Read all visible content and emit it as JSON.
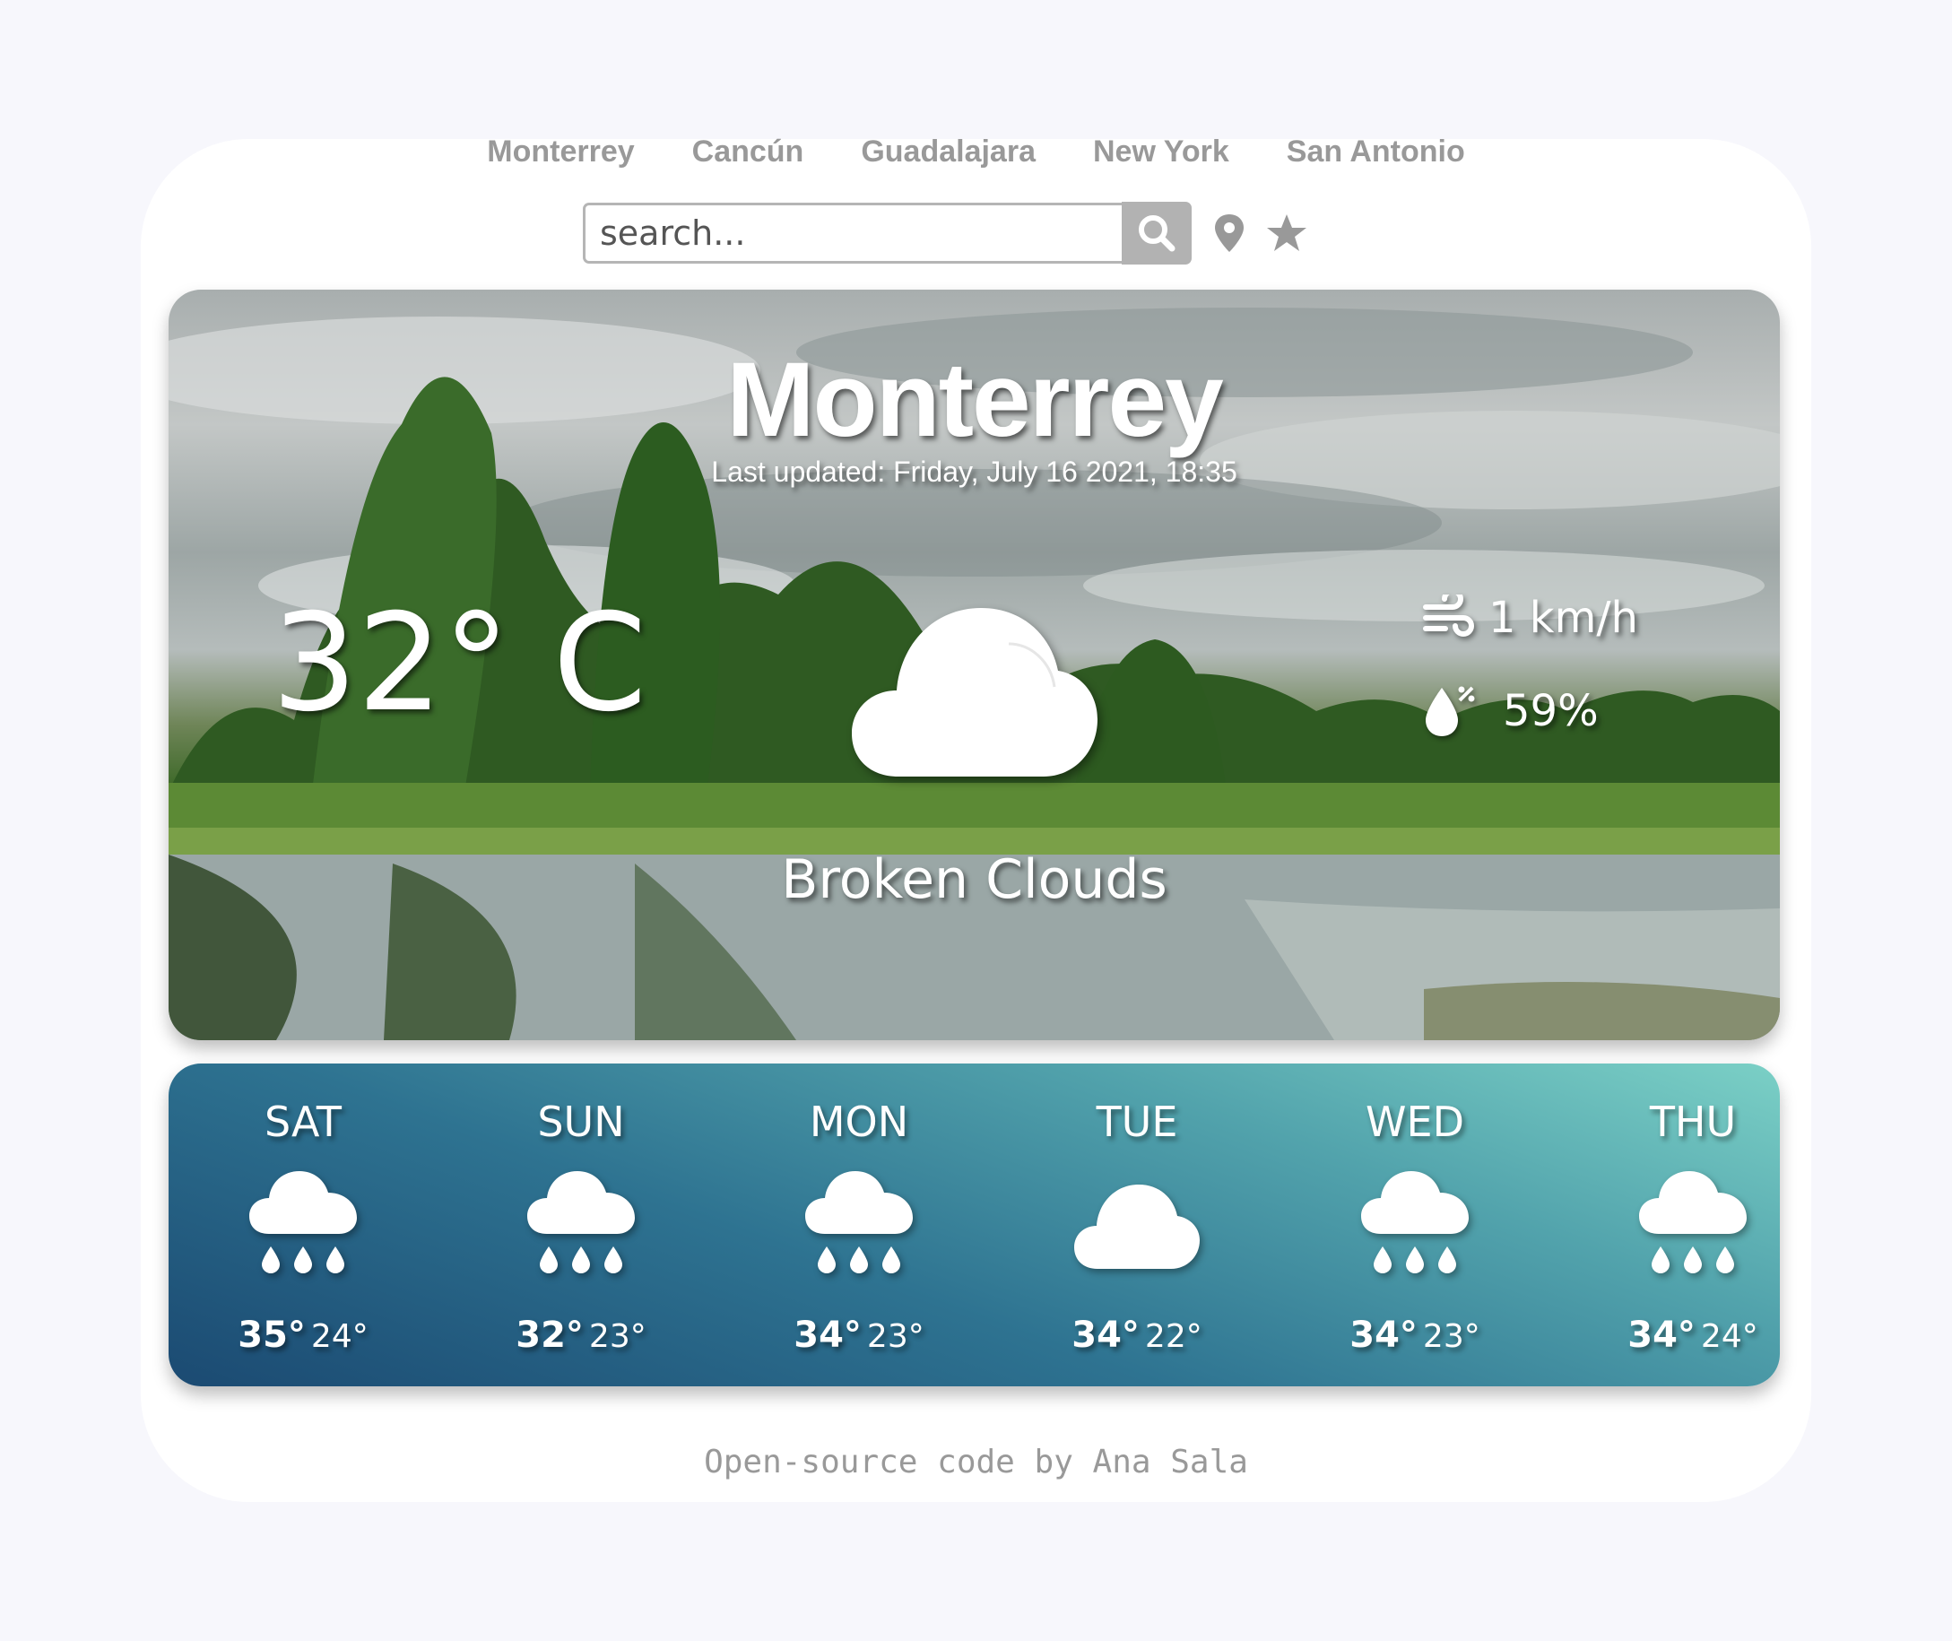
{
  "nav": {
    "cities": [
      "Monterrey",
      "Cancún",
      "Guadalajara",
      "New York",
      "San Antonio"
    ]
  },
  "search": {
    "placeholder": "search...",
    "value": "",
    "button_icon": "search-icon",
    "location_icon": "map-pin-icon",
    "favorite_icon": "star-icon"
  },
  "current": {
    "city": "Monterrey",
    "last_updated": "Last updated: Friday, July 16 2021, 18:35",
    "temperature": "32° C",
    "description": "Broken Clouds",
    "icon": "cloud-icon",
    "wind": "1 km/h",
    "wind_icon": "wind-icon",
    "humidity": "59%",
    "humidity_icon": "humidity-icon"
  },
  "forecast": [
    {
      "day": "SAT",
      "max": "35°",
      "min": "24°",
      "icon": "rain-icon"
    },
    {
      "day": "SUN",
      "max": "32°",
      "min": "23°",
      "icon": "rain-icon"
    },
    {
      "day": "MON",
      "max": "34°",
      "min": "23°",
      "icon": "rain-icon"
    },
    {
      "day": "TUE",
      "max": "34°",
      "min": "22°",
      "icon": "cloud-icon"
    },
    {
      "day": "WED",
      "max": "34°",
      "min": "23°",
      "icon": "rain-icon"
    },
    {
      "day": "THU",
      "max": "34°",
      "min": "24°",
      "icon": "rain-icon"
    }
  ],
  "footer": {
    "text": "Open-source code by Ana Sala"
  },
  "colors": {
    "page_background": "#f7f7fc",
    "nav_text": "#999999",
    "forecast_gradient_start": "#1b4a72",
    "forecast_gradient_end": "#7bd0c6"
  }
}
